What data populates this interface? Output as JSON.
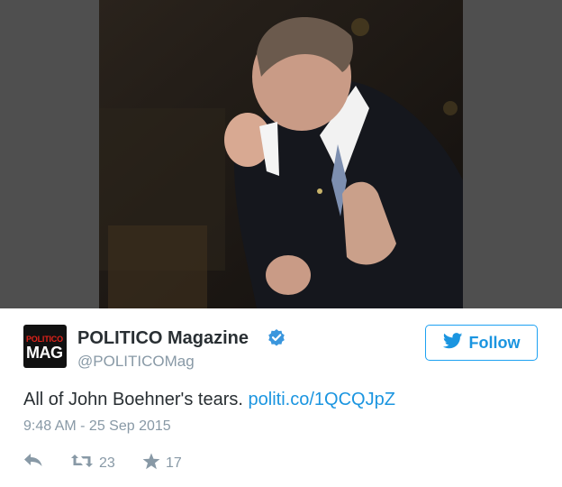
{
  "tweet": {
    "avatar": {
      "line1": "POLITICO",
      "line2": "MAG"
    },
    "author_name": "POLITICO Magazine",
    "author_handle": "@POLITICOMag",
    "follow_label": "Follow",
    "text": "All of John Boehner's tears. ",
    "link": "politi.co/1QCQJpZ",
    "timestamp": "9:48 AM - 25 Sep 2015",
    "retweet_count": "23",
    "favorite_count": "17"
  },
  "icons": {
    "verified": "verified-badge-icon",
    "follow": "twitter-bird-icon",
    "reply": "reply-icon",
    "retweet": "retweet-icon",
    "favorite": "star-icon"
  },
  "colors": {
    "accent": "#1b95e0",
    "text": "#292f33",
    "muted": "#8899a6",
    "media_background": "#4f4f4f"
  }
}
